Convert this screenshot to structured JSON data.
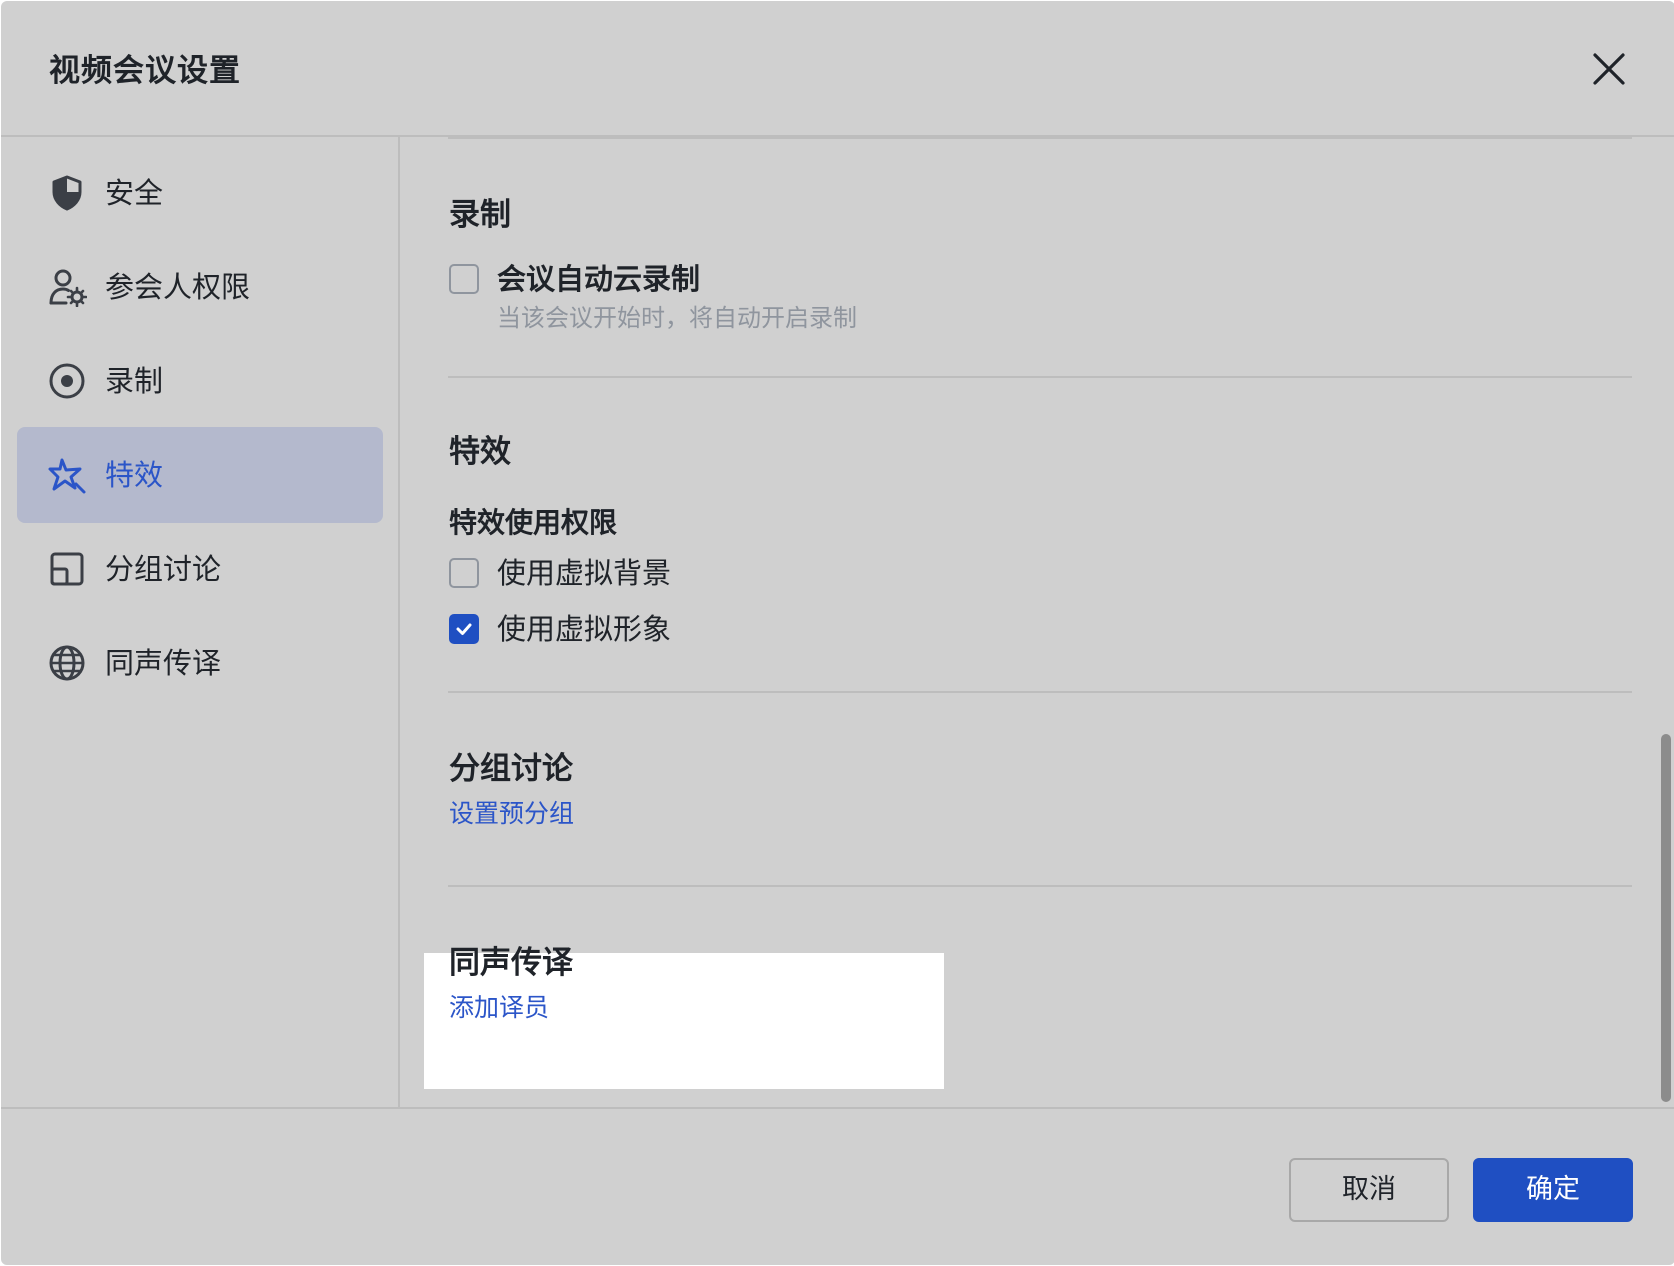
{
  "dialog": {
    "title": "视频会议设置"
  },
  "sidebar": {
    "items": [
      {
        "label": "安全",
        "icon": "shield-icon"
      },
      {
        "label": "参会人权限",
        "icon": "user-settings-icon"
      },
      {
        "label": "录制",
        "icon": "record-icon"
      },
      {
        "label": "特效",
        "icon": "sparkle-icon",
        "active": true
      },
      {
        "label": "分组讨论",
        "icon": "breakout-icon"
      },
      {
        "label": "同声传译",
        "icon": "globe-icon"
      }
    ]
  },
  "content": {
    "recording": {
      "title": "录制",
      "auto_cloud_record": {
        "label": "会议自动云录制",
        "description": "当该会议开始时，将自动开启录制",
        "checked": false
      }
    },
    "effects": {
      "title": "特效",
      "permission_title": "特效使用权限",
      "virtual_background": {
        "label": "使用虚拟背景",
        "checked": false
      },
      "virtual_avatar": {
        "label": "使用虚拟形象",
        "checked": true
      }
    },
    "breakout": {
      "title": "分组讨论",
      "link": "设置预分组"
    },
    "interpretation": {
      "title": "同声传译",
      "link": "添加译员"
    }
  },
  "footer": {
    "cancel_label": "取消",
    "ok_label": "确定"
  },
  "colors": {
    "accent": "#1f4fc2",
    "link": "#2b55c8",
    "background": "#d0d0d0",
    "active_nav": "#b4b9cd"
  }
}
